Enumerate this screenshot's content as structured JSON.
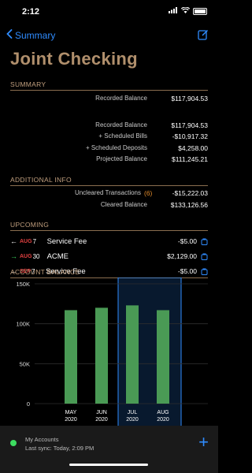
{
  "status": {
    "time": "2:12"
  },
  "nav": {
    "back_label": "Summary",
    "edit_icon": "edit-icon"
  },
  "title": "Joint Checking",
  "summary": {
    "header": "SUMMARY",
    "recorded_label": "Recorded Balance",
    "recorded_value": "$117,904.53",
    "rows": [
      {
        "label": "Recorded Balance",
        "value": "$117,904.53"
      },
      {
        "label": "+ Scheduled Bills",
        "value": "-$10,917.32"
      },
      {
        "label": "+ Scheduled Deposits",
        "value": "$4,258.00"
      },
      {
        "label": "Projected Balance",
        "value": "$111,245.21"
      }
    ]
  },
  "additional": {
    "header": "ADDITIONAL INFO",
    "uncleared_label": "Uncleared Transactions",
    "uncleared_count": "(6)",
    "uncleared_value": "-$15,222.03",
    "cleared_label": "Cleared Balance",
    "cleared_value": "$133,126.56"
  },
  "upcoming": {
    "header": "UPCOMING",
    "items": [
      {
        "arrow": "←",
        "arrow_color": "#ffffff",
        "month": "AUG",
        "day": "7",
        "name": "Service Fee",
        "amount": "-$5.00"
      },
      {
        "arrow": "→",
        "arrow_color": "#3ddc60",
        "month": "AUG",
        "day": "30",
        "name": "ACME",
        "amount": "$2,129.00"
      },
      {
        "arrow": "←",
        "arrow_color": "#ffffff",
        "month": "SEP",
        "day": "7",
        "name": "Service Fee",
        "amount": "-$5.00"
      }
    ]
  },
  "balance_chart": {
    "header": "ACCOUNT BALANCE"
  },
  "chart_data": {
    "type": "bar",
    "categories": [
      "MAY\n2020",
      "JUN\n2020",
      "JUL\n2020",
      "AUG\n2020"
    ],
    "category_labels": [
      [
        "MAY",
        "2020"
      ],
      [
        "JUN",
        "2020"
      ],
      [
        "JUL",
        "2020"
      ],
      [
        "AUG",
        "2020"
      ]
    ],
    "values": [
      117000,
      120000,
      123000,
      117000
    ],
    "ylim": [
      0,
      150000
    ],
    "yticks": [
      "150K",
      "100K",
      "50K",
      "0"
    ],
    "ytick_values": [
      150000,
      100000,
      50000,
      0
    ],
    "selected_index": 2,
    "bar_color": "#4a9a55",
    "highlight_color": "#2f8cff",
    "grid": true
  },
  "footer": {
    "account_label": "My Accounts",
    "sync_label": "Last sync: Today, 2:09 PM",
    "add_icon": "+"
  }
}
